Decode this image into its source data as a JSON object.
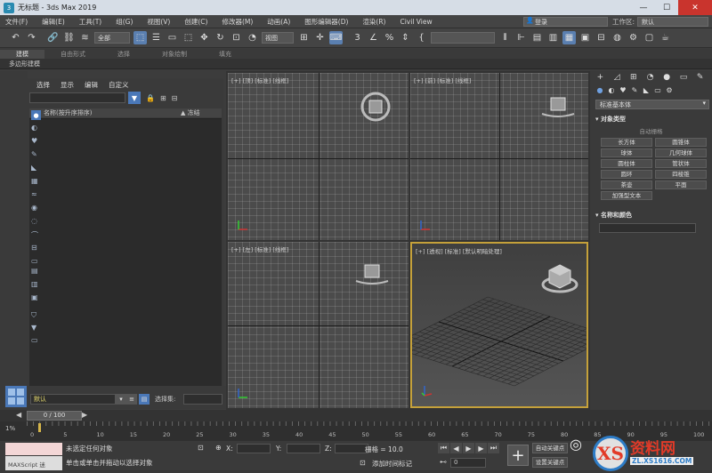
{
  "window": {
    "title": "无标题 - 3ds Max 2019",
    "app_icon": "3"
  },
  "menubar": {
    "items": [
      "文件(F)",
      "编辑(E)",
      "工具(T)",
      "组(G)",
      "视图(V)",
      "创建(C)",
      "修改器(M)",
      "动画(A)",
      "图形编辑器(D)",
      "渲染(R)",
      "Civil View"
    ],
    "login": "登录",
    "workspace_label": "工作区:",
    "workspace_value": "默认"
  },
  "toolbar": {
    "selection_filter": "全部",
    "ref_coord": "视图"
  },
  "ribbon": {
    "tabs": [
      "建模",
      "自由形式",
      "选择",
      "对象绘制",
      "填充"
    ],
    "sub_label": "多边形建模"
  },
  "scene_explorer": {
    "menus": [
      "选择",
      "显示",
      "编辑",
      "自定义"
    ],
    "col_name": "名称(按升序排序)",
    "col_frozen": "▲ 冻结"
  },
  "bottom_left": {
    "layer": "默认",
    "selection_set_label": "选择集:"
  },
  "viewports": {
    "top_label": "[+] [顶] [标准] [线框]",
    "front_label": "[+] [前] [标准] [线框]",
    "left_label": "[+] [左] [标准] [线框]",
    "persp_label": "[+] [透视] [标准] [默认明暗处理]"
  },
  "command_panel": {
    "category": "标准基本体",
    "object_type_title": "对象类型",
    "autogrid": "自动栅格",
    "objects": [
      "长方体",
      "圆锥体",
      "球体",
      "几何球体",
      "圆柱体",
      "管状体",
      "圆环",
      "四棱锥",
      "茶壶",
      "平面"
    ],
    "extra": "加强型文本",
    "name_color_title": "名称和颜色",
    "color": "#c23b8a"
  },
  "timeline": {
    "frame_display": "0 / 100",
    "percent": "1%",
    "ticks": [
      "0",
      "5",
      "10",
      "15",
      "20",
      "25",
      "30",
      "35",
      "40",
      "45",
      "50",
      "55",
      "60",
      "65",
      "70",
      "75",
      "80",
      "85",
      "90",
      "95",
      "100"
    ]
  },
  "status": {
    "maxscript": "MAXScript 迷",
    "msg1": "未选定任何对象",
    "msg2": "单击或单击并拖动以选择对象",
    "x_label": "X:",
    "y_label": "Y:",
    "z_label": "Z:",
    "grid": "栅格 = 10.0",
    "add_time_tag": "添加时间标记",
    "frame": "0",
    "auto_key": "自动关键点",
    "set_key": "设置关键点"
  },
  "watermark": {
    "logo_char": "XS",
    "title": "资料网",
    "url": "ZL.XS1616.COM"
  }
}
